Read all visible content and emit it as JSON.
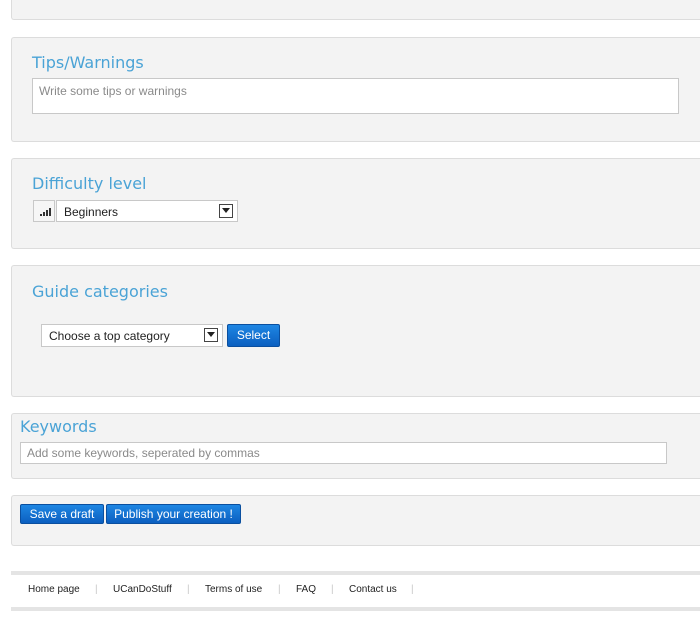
{
  "tips": {
    "title": "Tips/Warnings",
    "placeholder": "Write some tips or warnings"
  },
  "difficulty": {
    "title": "Difficulty level",
    "icon": "signal-bars-icon",
    "selected": "Beginners"
  },
  "categories": {
    "title": "Guide categories",
    "selected": "Choose a top category",
    "select_button": "Select"
  },
  "keywords": {
    "title": "Keywords",
    "placeholder": "Add some keywords, seperated by commas"
  },
  "actions": {
    "save_draft": "Save a draft",
    "publish": "Publish your creation !"
  },
  "footer": {
    "links": [
      "Home page",
      "UCanDoStuff",
      "Terms of use",
      "FAQ",
      "Contact us"
    ],
    "separator": "|"
  },
  "colors": {
    "heading": "#4aa3d6",
    "button": "#0b5fc0",
    "panel_bg": "#f3f3f3"
  }
}
